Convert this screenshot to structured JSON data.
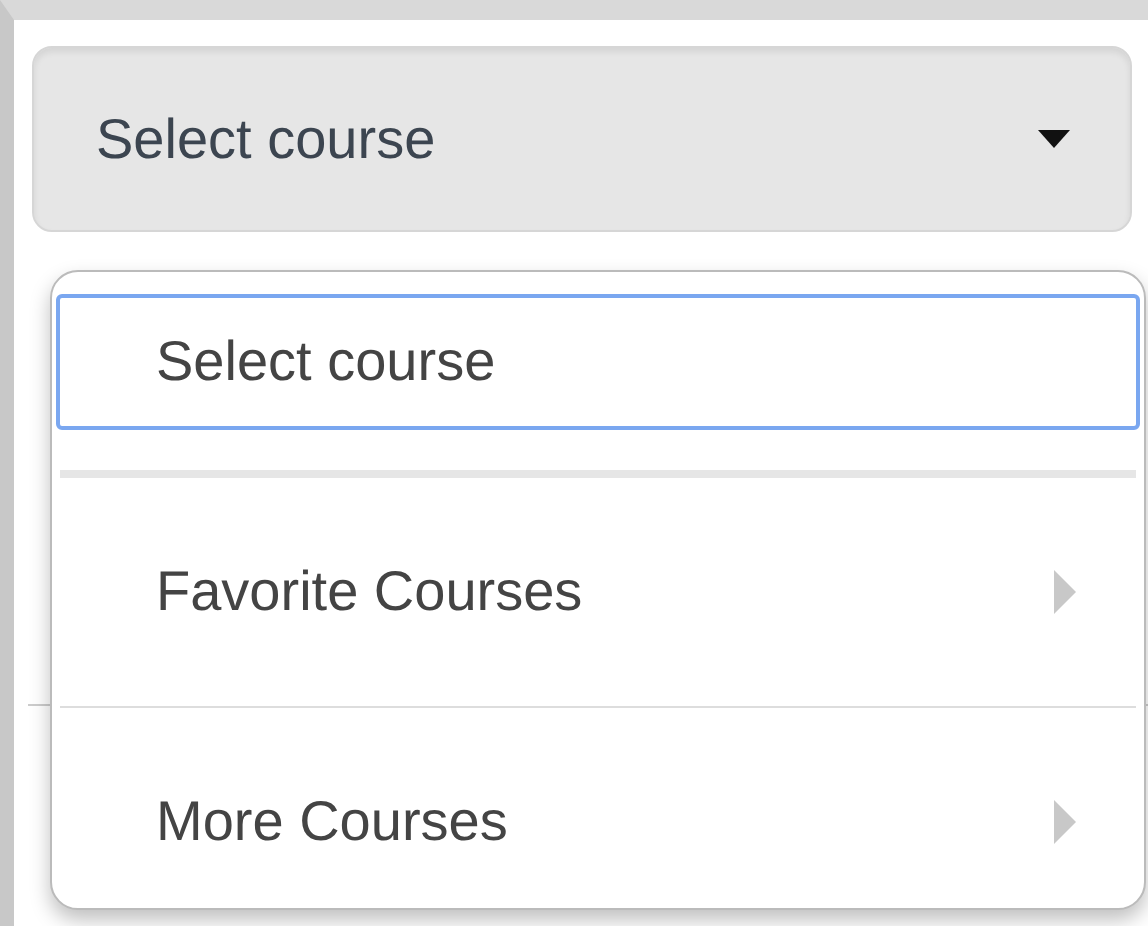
{
  "dropdown": {
    "label": "Select course"
  },
  "menu": {
    "items": [
      {
        "label": "Select course",
        "kind": "option",
        "selected": true
      },
      {
        "label": "Favorite Courses",
        "kind": "submenu",
        "selected": false
      },
      {
        "label": "More Courses",
        "kind": "submenu",
        "selected": false
      }
    ]
  }
}
